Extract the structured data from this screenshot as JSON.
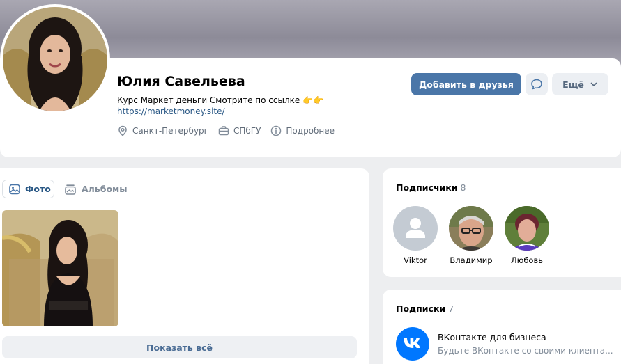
{
  "profile": {
    "name": "Юлия Савельева",
    "status_text": "Курс Маркет деньги Смотрите по ссылке 👉👉",
    "status_link": "https://marketmoney.site/",
    "info": [
      {
        "icon": "location-pin-icon",
        "label": "Санкт-Петербург"
      },
      {
        "icon": "briefcase-icon",
        "label": "СПбГУ"
      },
      {
        "icon": "info-icon",
        "label": "Подробнее"
      }
    ]
  },
  "actions": {
    "add_friend": "Добавить в друзья",
    "message_icon": "message-bubble-icon",
    "more": "Ещё"
  },
  "photos": {
    "tab_photo": "Фото",
    "tab_albums": "Альбомы",
    "show_all": "Показать всё"
  },
  "followers": {
    "title": "Подписчики",
    "count": "8",
    "items": [
      {
        "name": "Viktor"
      },
      {
        "name": "Владимир"
      },
      {
        "name": "Любовь"
      }
    ]
  },
  "subscriptions": {
    "title": "Подписки",
    "count": "7",
    "items": [
      {
        "name": "ВКонтакте для бизнеса",
        "description": "Будьте ВКонтакте со своими клиента..."
      }
    ]
  },
  "colors": {
    "accent": "#4a76a8",
    "link": "#2a5885",
    "vk_blue": "#0077ff",
    "page_bg": "#edeef0"
  }
}
